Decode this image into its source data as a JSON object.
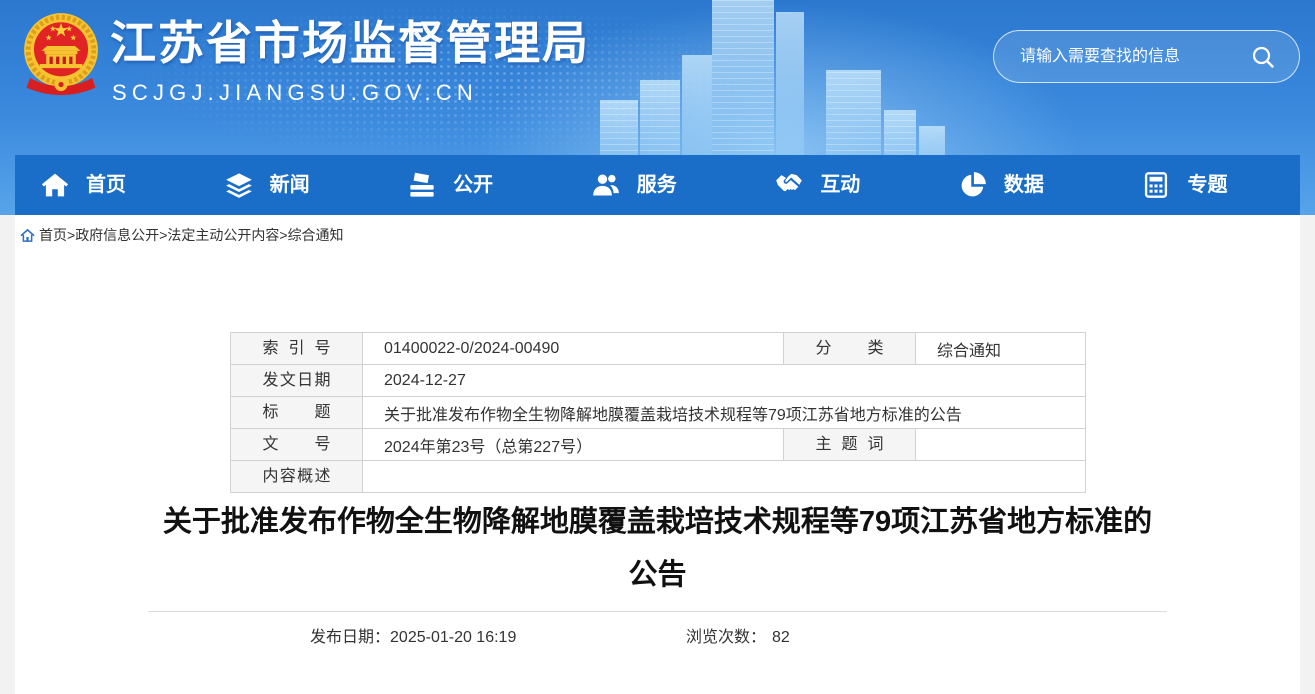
{
  "site": {
    "title": "江苏省市场监督管理局",
    "domain": "SCJGJ.JIANGSU.GOV.CN",
    "logo": "national-emblem-icon"
  },
  "search": {
    "placeholder": "请输入需要查找的信息",
    "icon": "search-icon"
  },
  "nav": {
    "items": [
      {
        "label": "首页",
        "icon": "home-icon"
      },
      {
        "label": "新闻",
        "icon": "layers-icon"
      },
      {
        "label": "公开",
        "icon": "stack-icon"
      },
      {
        "label": "服务",
        "icon": "users-icon"
      },
      {
        "label": "互动",
        "icon": "handshake-icon"
      },
      {
        "label": "数据",
        "icon": "pie-chart-icon"
      },
      {
        "label": "专题",
        "icon": "calculator-icon"
      }
    ]
  },
  "breadcrumb": {
    "icon": "home-icon",
    "separator": ">",
    "items": [
      "首页",
      "政府信息公开",
      "法定主动公开内容",
      "综合通知"
    ]
  },
  "info_table": {
    "index_label": "索 引 号",
    "index_value": "01400022-0/2024-00490",
    "category_label": "分 类",
    "category_value": "综合通知",
    "date_label": "发文日期",
    "date_value": "2024-12-27",
    "title_label": "标 题",
    "title_value": "关于批准发布作物全生物降解地膜覆盖栽培技术规程等79项江苏省地方标准的公告",
    "doc_no_label": "文 号",
    "doc_no_value": "2024年第23号（总第227号）",
    "keywords_label": "主 题 词",
    "summary_label": "内容概述"
  },
  "article": {
    "title": "关于批准发布作物全生物降解地膜覆盖栽培技术规程等79项江苏省地方标准的公告",
    "publish_label": "发布日期：",
    "publish_value": "2025-01-20 16:19",
    "views_label": "浏览次数：",
    "views_value": "82"
  },
  "colors": {
    "header_top": "#2b78cf",
    "nav_bg": "#1b6ec8",
    "label_bg": "#f5f5f5",
    "border": "#d2d2d2"
  }
}
